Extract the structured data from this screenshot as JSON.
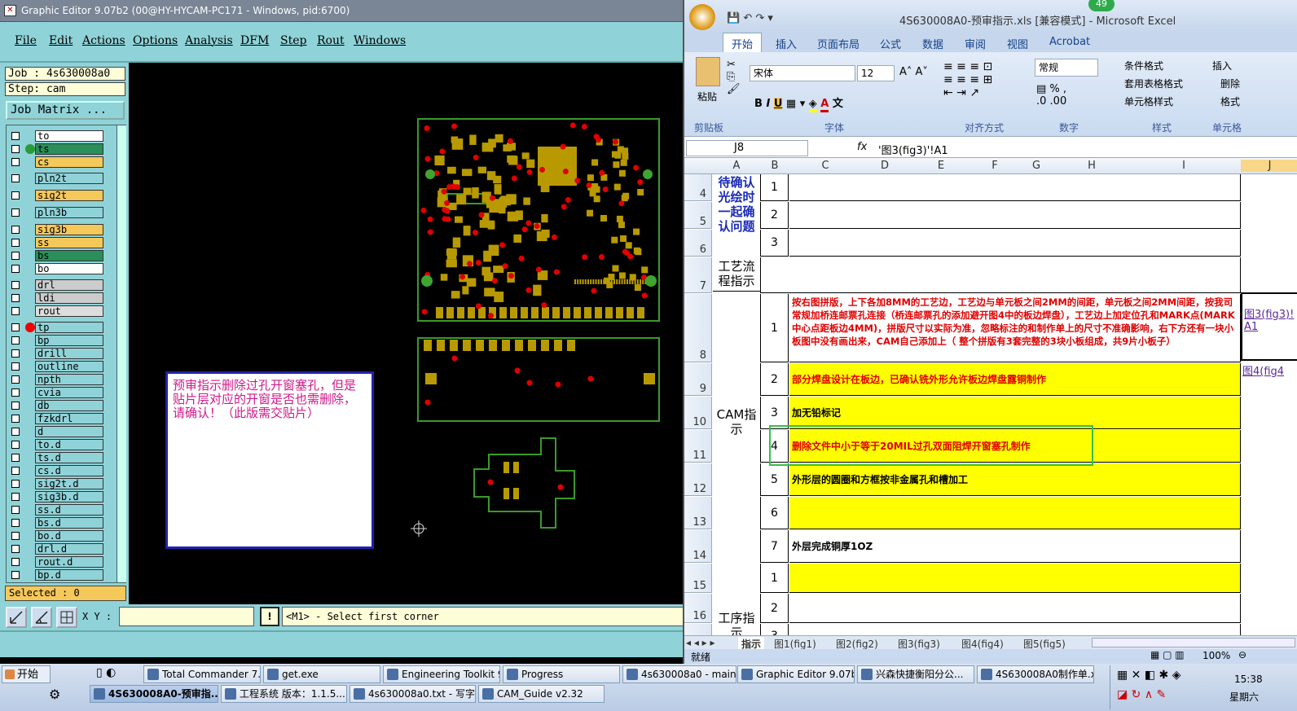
{
  "graphic_editor": {
    "title": "Graphic Editor 9.07b2 (00@HY-HYCAM-PC171 - Windows, pid:6700)",
    "menu": [
      "File",
      "Edit",
      "Actions",
      "Options",
      "Analysis",
      "DFM",
      "Step",
      "Rout",
      "Windows"
    ],
    "job": "Job : 4s630008a0",
    "step": "Step: cam",
    "job_matrix": "Job Matrix ...",
    "layers": [
      "to",
      "ts",
      "cs",
      "pln2t",
      "sig2t",
      "pln3b",
      "sig3b",
      "ss",
      "bs",
      "bo",
      "drl",
      "ldi",
      "rout",
      "tp",
      "bp",
      "drill",
      "outline",
      "npth",
      "cvia",
      "db",
      "fzkdrl",
      "d",
      "to.d",
      "ts.d",
      "cs.d",
      "sig2t.d",
      "sig3b.d",
      "ss.d",
      "bs.d",
      "bo.d",
      "drl.d",
      "rout.d",
      "bp.d"
    ],
    "selected": "Selected : 0",
    "xy_label": "X Y :",
    "xy_value": "",
    "bang": "!",
    "prompt": "<M1> - Select first corner",
    "note": "预审指示删除过孔开窗塞孔，但是贴片层对应的开窗是否也需删除，请确认！（此版需交贴片）"
  },
  "excel": {
    "title": "4S630008A0-预审指示.xls  [兼容模式] - Microsoft Excel",
    "badge": "49",
    "tabs": [
      "开始",
      "插入",
      "页面布局",
      "公式",
      "数据",
      "审阅",
      "视图",
      "Acrobat"
    ],
    "ribbon": {
      "paste": "粘贴",
      "font_name": "宋体",
      "font_size": "12",
      "number_format": "常规",
      "cond_format": "条件格式",
      "table_format": "套用表格格式",
      "cell_style": "单元格样式",
      "insert": "插入",
      "delete": "删除",
      "format": "格式",
      "groups": [
        "剪贴板",
        "字体",
        "对齐方式",
        "数字",
        "样式",
        "单元格"
      ]
    },
    "name_box": "J8",
    "formula": "'图3(fig3)'!A1",
    "columns": [
      "A",
      "B",
      "C",
      "D",
      "E",
      "F",
      "G",
      "H",
      "I",
      "J"
    ],
    "rows": [
      {
        "num": "4",
        "b": "1",
        "text": ""
      },
      {
        "num": "5",
        "b": "2",
        "text": ""
      },
      {
        "num": "6",
        "b": "3",
        "text": ""
      },
      {
        "num": "7",
        "b": "",
        "text": ""
      },
      {
        "num": "8",
        "b": "1",
        "text": "按右图拼版，上下各加8MM的工艺边，工艺边与单元板之间2MM的间距，单元板之间2MM间距，按我司常规加桥连邮票孔连接（桥连邮票孔的添加避开图4中的板边焊盘），工艺边上加定位孔和MARK点(MARK中心点距板边4MM)，拼版尺寸以实际为准，忽略标注的和制作单上的尺寸不准确影响，右下方还有一块小板图中没有画出来，CAM自己添加上（ 整个拼版有3套完整的3块小板组成，共9片小板子）"
      },
      {
        "num": "9",
        "b": "2",
        "text": "部分焊盘设计在板边，已确认铣外形允许板边焊盘露铜制作"
      },
      {
        "num": "10",
        "b": "3",
        "text": "加无铅标记"
      },
      {
        "num": "11",
        "b": "4",
        "text": "删除文件中小于等于20MIL过孔双面阻焊开窗塞孔制作"
      },
      {
        "num": "12",
        "b": "5",
        "text": "外形层的圆圈和方框按非金属孔和槽加工"
      },
      {
        "num": "13",
        "b": "6",
        "text": ""
      },
      {
        "num": "14",
        "b": "7",
        "text": "外层完成铜厚1OZ"
      },
      {
        "num": "15",
        "b": "1",
        "text": ""
      },
      {
        "num": "16",
        "b": "2",
        "text": ""
      },
      {
        "num": "17",
        "b": "3",
        "text": ""
      }
    ],
    "a_labels": {
      "pending": "待确认光绘时一起确认问题",
      "process": "工艺流程指示",
      "cam": "CAM指示",
      "proc": "工序指示"
    },
    "links": {
      "j8": "图3(fig3)!A1",
      "j9": "图4(fig4"
    },
    "sheet_tabs": [
      "指示",
      "图1(fig1)",
      "图2(fig2)",
      "图3(fig3)",
      "图4(fig4)",
      "图5(fig5)"
    ],
    "status": "就绪",
    "zoom": "100%"
  },
  "taskbar": {
    "start": "开始",
    "row1": [
      "Total Commander 7.0 ...",
      "get.exe",
      "Engineering Toolkit 9....",
      "Progress",
      "4s630008a0 - main_qa",
      "Graphic Editor 9.07b2 ...",
      "兴森快捷衡阳分公...",
      "4S630008A0制作单.x..."
    ],
    "row2": [
      "4S630008A0-预审指...",
      "工程系统  版本：1.1.5...",
      "4s630008a0.txt - 写字板",
      "CAM_Guide v2.32"
    ],
    "clock": "15:38",
    "day": "星期六"
  }
}
